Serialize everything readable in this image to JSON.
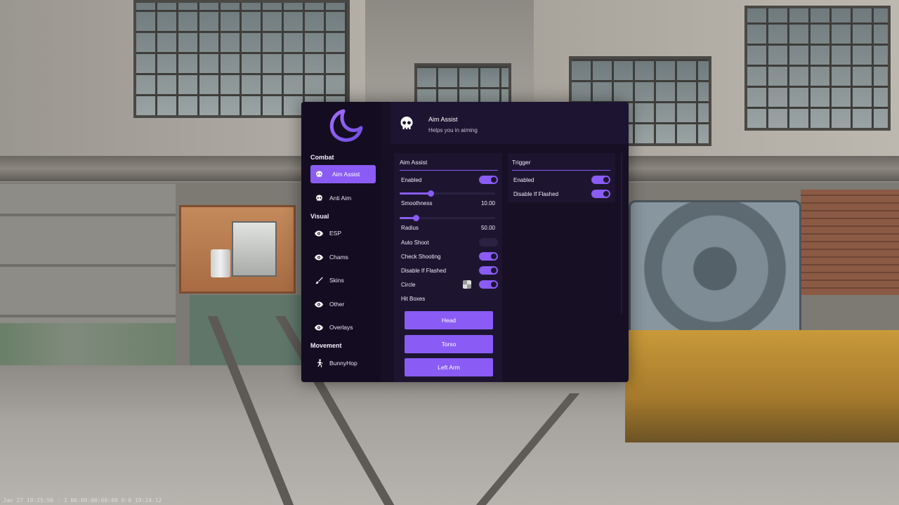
{
  "status_bar": "Jan 27 19:25:56 - 1 00:00:00:00:00 0:0 19:24:12",
  "colors": {
    "accent": "#8a5cf5",
    "window_bg": "#170f24",
    "panel_bg": "#1d1530"
  },
  "header": {
    "icon": "skull-icon",
    "title": "Aim Assist",
    "subtitle": "Helps you in aiming"
  },
  "sidebar": {
    "sections": [
      {
        "label": "Combat",
        "items": [
          {
            "label": "Aim Assist",
            "icon": "skull-icon",
            "active": true
          },
          {
            "label": "Anti Aim",
            "icon": "skull-icon",
            "active": false
          }
        ]
      },
      {
        "label": "Visual",
        "items": [
          {
            "label": "ESP",
            "icon": "eye-icon"
          },
          {
            "label": "Chams",
            "icon": "eye-icon"
          },
          {
            "label": "Skins",
            "icon": "brush-icon"
          },
          {
            "label": "Other",
            "icon": "eye-icon"
          },
          {
            "label": "Overlays",
            "icon": "eye-icon"
          }
        ]
      },
      {
        "label": "Movement",
        "items": [
          {
            "label": "BunnyHop",
            "icon": "running-icon"
          }
        ]
      }
    ]
  },
  "aim_assist": {
    "title": "Aim Assist",
    "enabled": {
      "label": "Enabled",
      "on": true
    },
    "smoothness": {
      "label": "Smoothness",
      "value": "10.00",
      "fraction": 0.33
    },
    "radius": {
      "label": "Radius",
      "value": "50.00",
      "fraction": 0.17
    },
    "auto_shoot": {
      "label": "Auto Shoot",
      "on": false
    },
    "check_shooting": {
      "label": "Check Shooting",
      "on": true
    },
    "disable_if_flashed": {
      "label": "Disable If Flashed",
      "on": true
    },
    "circle": {
      "label": "Circle",
      "on": true
    },
    "hit_boxes": {
      "label": "Hit Boxes",
      "buttons": [
        "Head",
        "Torso",
        "Left Arm"
      ]
    }
  },
  "trigger": {
    "title": "Trigger",
    "enabled": {
      "label": "Enabled",
      "on": true
    },
    "disable_if_flashed": {
      "label": "Disable If Flashed",
      "on": true
    }
  }
}
